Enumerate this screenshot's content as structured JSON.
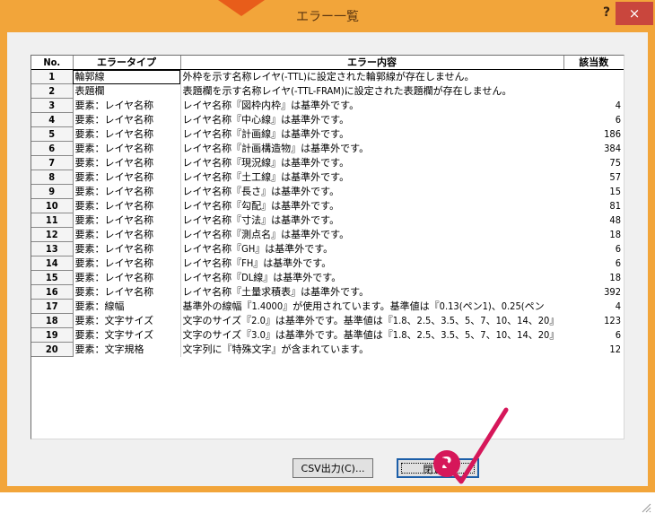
{
  "window": {
    "title": "エラー一覧",
    "help": "?",
    "close": "×"
  },
  "table": {
    "headers": {
      "no": "No.",
      "type": "エラータイプ",
      "content": "エラー内容",
      "count": "該当数"
    },
    "rows": [
      {
        "no": "1",
        "type": "輪郭線",
        "content": "外枠を示す名称レイヤ(-TTL)に設定された輪郭線が存在しません。",
        "count": ""
      },
      {
        "no": "2",
        "type": "表題欄",
        "content": "表題欄を示す名称レイヤ(-TTL-FRAM)に設定された表題欄が存在しません。",
        "count": ""
      },
      {
        "no": "3",
        "type": "要素：レイヤ名称",
        "content": "レイヤ名称『図枠内枠』は基準外です。",
        "count": "4"
      },
      {
        "no": "4",
        "type": "要素：レイヤ名称",
        "content": "レイヤ名称『中心線』は基準外です。",
        "count": "6"
      },
      {
        "no": "5",
        "type": "要素：レイヤ名称",
        "content": "レイヤ名称『計画線』は基準外です。",
        "count": "186"
      },
      {
        "no": "6",
        "type": "要素：レイヤ名称",
        "content": "レイヤ名称『計画構造物』は基準外です。",
        "count": "384"
      },
      {
        "no": "7",
        "type": "要素：レイヤ名称",
        "content": "レイヤ名称『現況線』は基準外です。",
        "count": "75"
      },
      {
        "no": "8",
        "type": "要素：レイヤ名称",
        "content": "レイヤ名称『土工線』は基準外です。",
        "count": "57"
      },
      {
        "no": "9",
        "type": "要素：レイヤ名称",
        "content": "レイヤ名称『長さ』は基準外です。",
        "count": "15"
      },
      {
        "no": "10",
        "type": "要素：レイヤ名称",
        "content": "レイヤ名称『勾配』は基準外です。",
        "count": "81"
      },
      {
        "no": "11",
        "type": "要素：レイヤ名称",
        "content": "レイヤ名称『寸法』は基準外です。",
        "count": "48"
      },
      {
        "no": "12",
        "type": "要素：レイヤ名称",
        "content": "レイヤ名称『測点名』は基準外です。",
        "count": "18"
      },
      {
        "no": "13",
        "type": "要素：レイヤ名称",
        "content": "レイヤ名称『GH』は基準外です。",
        "count": "6"
      },
      {
        "no": "14",
        "type": "要素：レイヤ名称",
        "content": "レイヤ名称『FH』は基準外です。",
        "count": "6"
      },
      {
        "no": "15",
        "type": "要素：レイヤ名称",
        "content": "レイヤ名称『DL線』は基準外です。",
        "count": "18"
      },
      {
        "no": "16",
        "type": "要素：レイヤ名称",
        "content": "レイヤ名称『土量求積表』は基準外です。",
        "count": "392"
      },
      {
        "no": "17",
        "type": "要素：線幅",
        "content": "基準外の線幅『1.4000』が使用されています。基準値は『0.13(ペン1)、0.25(ペン",
        "count": "4"
      },
      {
        "no": "18",
        "type": "要素：文字サイズ",
        "content": "文字のサイズ『2.0』は基準外です。基準値は『1.8、2.5、3.5、5、7、10、14、20』",
        "count": "123"
      },
      {
        "no": "19",
        "type": "要素：文字サイズ",
        "content": "文字のサイズ『3.0』は基準外です。基準値は『1.8、2.5、3.5、5、7、10、14、20』",
        "count": "6"
      },
      {
        "no": "20",
        "type": "要素：文字規格",
        "content": "文字列に『特殊文字』が含まれています。",
        "count": "12"
      }
    ]
  },
  "buttons": {
    "csv": "CSV出力(C)...",
    "close": "閉じる"
  },
  "annotation": {
    "step": "2"
  },
  "colors": {
    "titlebar": "#f2a53a",
    "close_button": "#c9463d",
    "badge": "#d6175a",
    "checkmark": "#d6175a",
    "pointer": "#e85d1a"
  }
}
